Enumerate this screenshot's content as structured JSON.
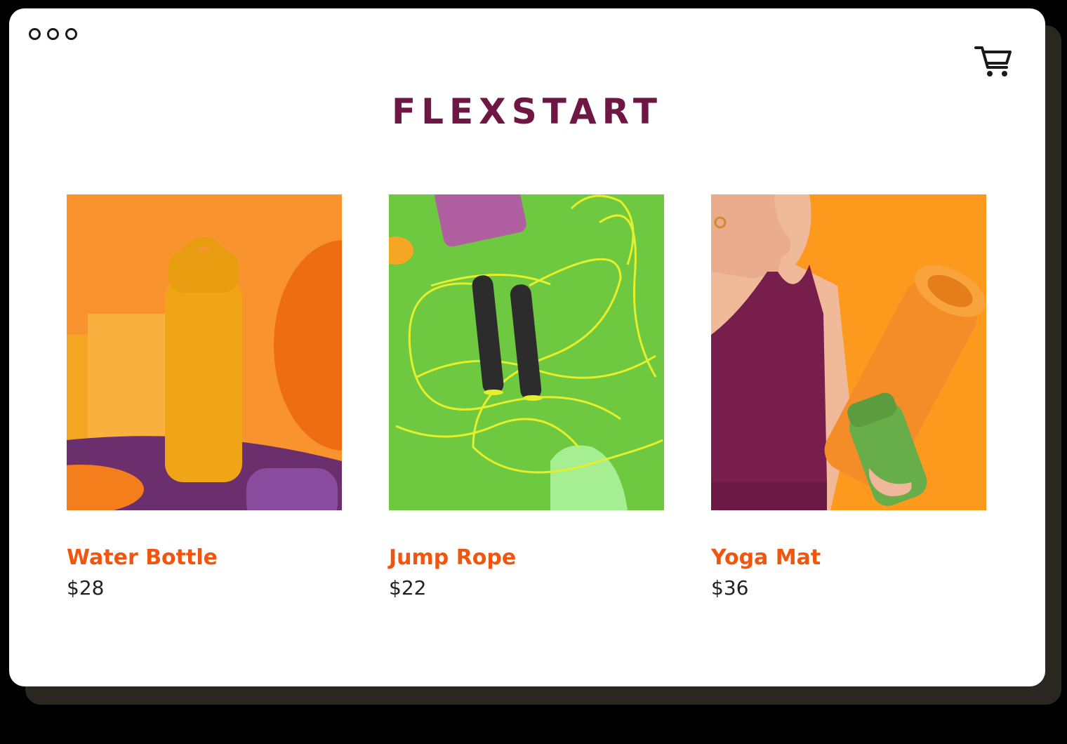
{
  "brand": {
    "name": "FLEXSTART",
    "color": "#6e1744"
  },
  "header": {
    "cart_icon": "shopping-cart-icon",
    "window_controls_icon": "three-dots-icon"
  },
  "theme": {
    "accent": "#f0560f",
    "price_color": "#222222"
  },
  "products": [
    {
      "title": "Water Bottle",
      "price": "$28",
      "image": "yellow-water-bottle-photo"
    },
    {
      "title": "Jump Rope",
      "price": "$22",
      "image": "jump-rope-on-green-photo"
    },
    {
      "title": "Yoga Mat",
      "price": "$36",
      "image": "woman-holding-yoga-mat-photo"
    }
  ]
}
